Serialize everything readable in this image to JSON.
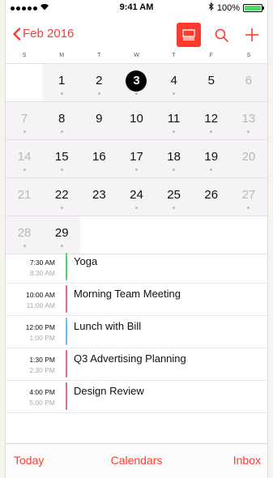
{
  "status_bar": {
    "time": "9:41 AM",
    "battery": "100%",
    "bluetooth_icon": "bluetooth-icon"
  },
  "nav": {
    "back_label": "Feb 2016"
  },
  "weekdays": [
    "S",
    "M",
    "T",
    "W",
    "T",
    "F",
    "S"
  ],
  "calendar": {
    "today": "3",
    "weeks": [
      [
        "",
        "1",
        "2",
        "3",
        "4",
        "5",
        "6"
      ],
      [
        "7",
        "8",
        "9",
        "10",
        "11",
        "12",
        "13"
      ],
      [
        "14",
        "15",
        "16",
        "17",
        "18",
        "19",
        "20"
      ],
      [
        "21",
        "22",
        "23",
        "24",
        "25",
        "26",
        "27"
      ],
      [
        "28",
        "29",
        "",
        "",
        "",
        "",
        ""
      ]
    ]
  },
  "events": [
    {
      "start": "7:30 AM",
      "end": "8:30 AM",
      "title": "Yoga",
      "color": "#4cd964"
    },
    {
      "start": "10:00 AM",
      "end": "11:00 AM",
      "title": "Morning Team Meeting",
      "color": "#e56a8f"
    },
    {
      "start": "12:00 PM",
      "end": "1:00 PM",
      "title": "Lunch with Bill",
      "color": "#5ac8fa"
    },
    {
      "start": "1:30 PM",
      "end": "2:30 PM",
      "title": "Q3 Advertising Planning",
      "color": "#e56a8f"
    },
    {
      "start": "4:00 PM",
      "end": "5:00 PM",
      "title": "Design Review",
      "color": "#e56a8f"
    }
  ],
  "tab_bar": {
    "today": "Today",
    "calendars": "Calendars",
    "inbox": "Inbox"
  },
  "colors": {
    "accent": "#ff3b30"
  }
}
